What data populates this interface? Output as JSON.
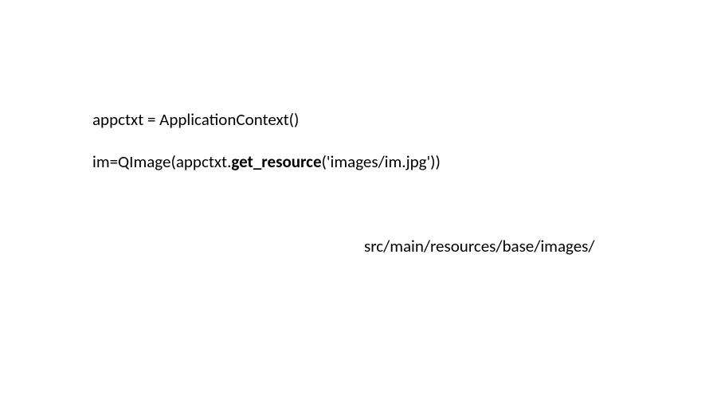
{
  "code": {
    "line1": {
      "prefix": "appctxt = ApplicationContext()"
    },
    "line2": {
      "part1": "im=QImage(appctxt.",
      "part2_bold": "get_resource",
      "part3": "('images/im.jpg'))"
    },
    "line3": {
      "path": "src/main/resources/base/images/"
    }
  }
}
